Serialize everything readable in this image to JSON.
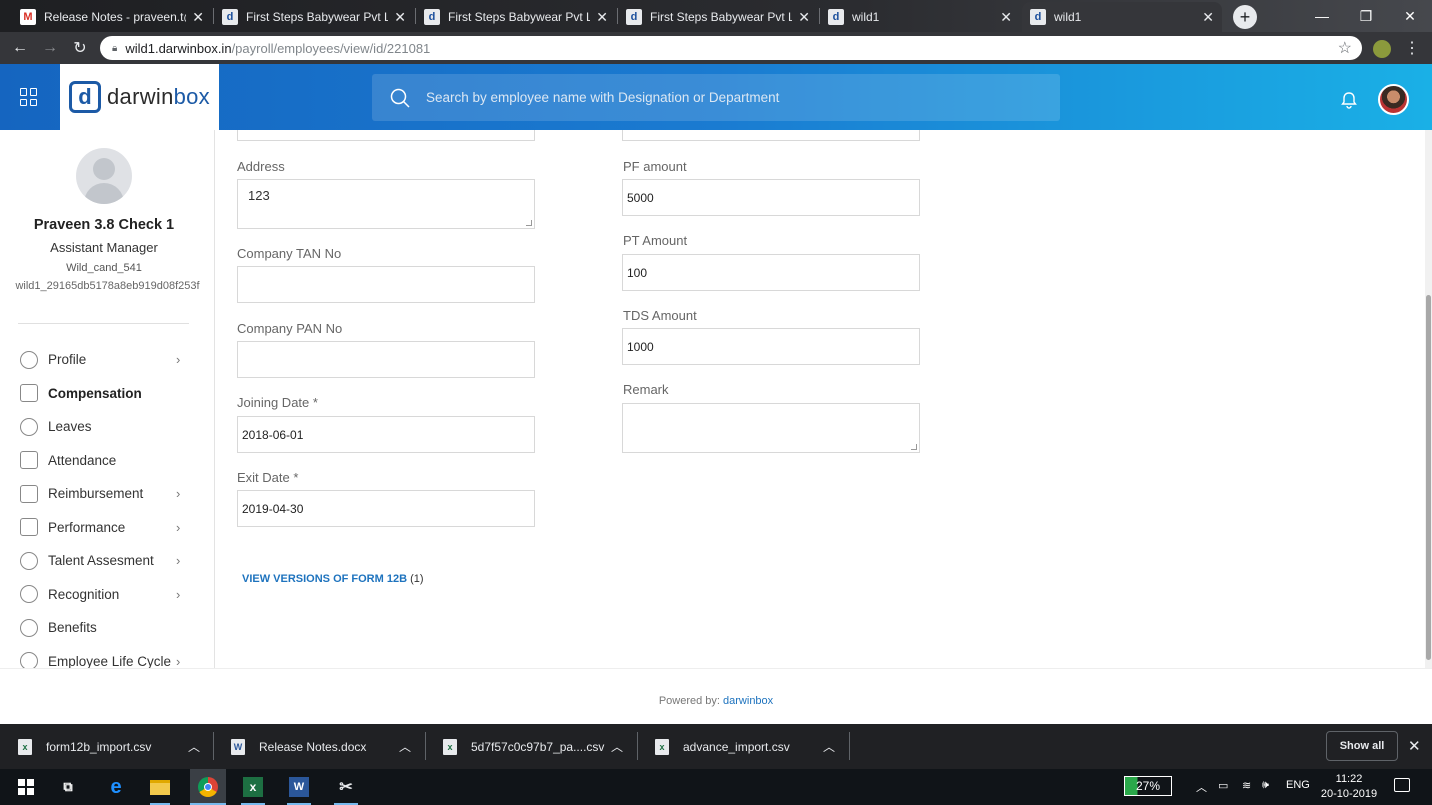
{
  "browser": {
    "tabs": [
      {
        "title": "Release Notes - praveen.t@d",
        "icon": "gmail-icon"
      },
      {
        "title": "First Steps Babywear Pvt Ltd",
        "icon": "darwinbox-icon"
      },
      {
        "title": "First Steps Babywear Pvt Ltd",
        "icon": "darwinbox-icon"
      },
      {
        "title": "First Steps Babywear Pvt Ltd",
        "icon": "darwinbox-icon"
      },
      {
        "title": "wild1",
        "icon": "darwinbox-icon"
      },
      {
        "title": "wild1",
        "icon": "darwinbox-icon",
        "active": true
      }
    ],
    "url_host": "wild1.darwinbox.in",
    "url_path": "/payroll/employees/view/id/221081"
  },
  "header": {
    "logo_text_dark": "darwin",
    "logo_text_blue": "box",
    "logo_mark": "d",
    "search_placeholder": "Search by employee name with Designation or Department"
  },
  "employee": {
    "name": "Praveen 3.8 Check 1",
    "designation": "Assistant Manager",
    "code": "Wild_cand_541",
    "id": "wild1_29165db5178a8eb919d08f253f"
  },
  "sidebar": {
    "items": [
      {
        "label": "Profile",
        "icon": "profile-icon",
        "chevron": true
      },
      {
        "label": "Compensation",
        "icon": "compensation-icon",
        "chevron": false,
        "active": true
      },
      {
        "label": "Leaves",
        "icon": "leaves-icon",
        "chevron": false
      },
      {
        "label": "Attendance",
        "icon": "attendance-icon",
        "chevron": false
      },
      {
        "label": "Reimbursement",
        "icon": "reimbursement-icon",
        "chevron": true
      },
      {
        "label": "Performance",
        "icon": "performance-icon",
        "chevron": true
      },
      {
        "label": "Talent Assesment",
        "icon": "talent-icon",
        "chevron": true
      },
      {
        "label": "Recognition",
        "icon": "recognition-icon",
        "chevron": true
      },
      {
        "label": "Benefits",
        "icon": "benefits-icon",
        "chevron": false
      },
      {
        "label": "Employee Life Cycle",
        "icon": "lifecycle-icon",
        "chevron": true
      }
    ]
  },
  "form": {
    "address_label": "Address",
    "address_value": "123",
    "tan_label": "Company TAN No",
    "tan_value": "",
    "pan_label": "Company PAN No",
    "pan_value": "",
    "joining_label": "Joining Date *",
    "joining_value": "2018-06-01",
    "exit_label": "Exit Date *",
    "exit_value": "2019-04-30",
    "pf_label": "PF amount",
    "pf_value": "5000",
    "pt_label": "PT Amount",
    "pt_value": "100",
    "tds_label": "TDS Amount",
    "tds_value": "1000",
    "remark_label": "Remark",
    "remark_value": "",
    "versions_link": "VIEW VERSIONS OF FORM 12B",
    "versions_count": "(1)"
  },
  "footer": {
    "powered_by": "Powered by:",
    "brand": "darwinbox"
  },
  "downloads": {
    "items": [
      {
        "name": "form12b_import.csv",
        "type": "excel"
      },
      {
        "name": "Release Notes.docx",
        "type": "word"
      },
      {
        "name": "5d7f57c0c97b7_pa....csv",
        "type": "excel"
      },
      {
        "name": "advance_import.csv",
        "type": "excel"
      }
    ],
    "show_all": "Show all"
  },
  "taskbar": {
    "battery": "27%",
    "language": "ENG",
    "time": "11:22",
    "date": "20-10-2019"
  },
  "colors": {
    "brand_blue": "#1c5aa6",
    "header_gradient_start": "#1565c0",
    "header_gradient_end": "#1ab0e6",
    "link_blue": "#1e73be"
  }
}
